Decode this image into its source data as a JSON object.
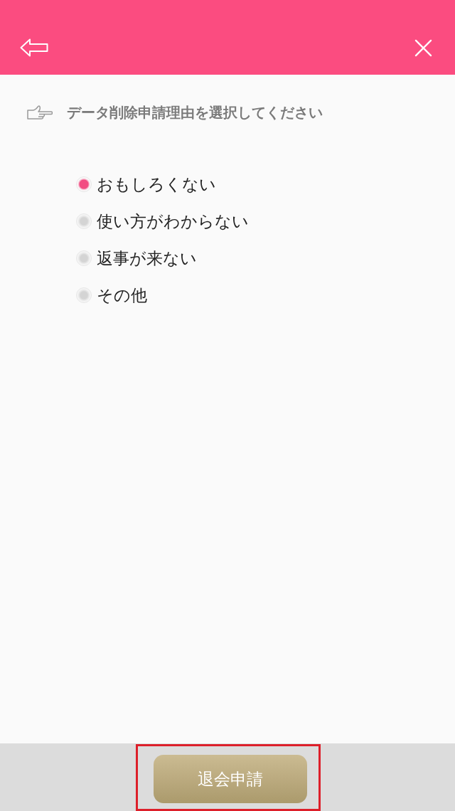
{
  "instruction": "データ削除申請理由を選択してください",
  "reasons": [
    {
      "label": "おもしろくない",
      "selected": true
    },
    {
      "label": "使い方がわからない",
      "selected": false
    },
    {
      "label": "返事が来ない",
      "selected": false
    },
    {
      "label": "その他",
      "selected": false
    }
  ],
  "submit_button": {
    "label": "退会申請",
    "highlighted": true
  }
}
